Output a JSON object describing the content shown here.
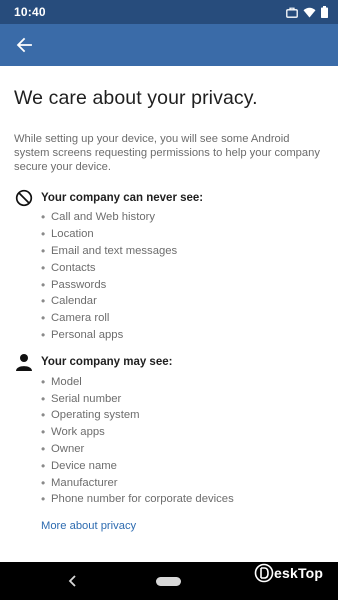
{
  "status_bar": {
    "time": "10:40",
    "icons": [
      "briefcase-icon",
      "wifi-icon",
      "battery-icon"
    ]
  },
  "app_bar": {
    "back_icon": "arrow-left-icon",
    "color": "#3a6ba8",
    "status_color": "#274c7c"
  },
  "page": {
    "title": "We care about your privacy.",
    "intro": "While setting up your device, you will see some Android system screens requesting permissions to help your company secure your device."
  },
  "never_see": {
    "icon": "blocked-icon",
    "title": "Your company can never see:",
    "items": [
      "Call and Web history",
      "Location",
      "Email and text messages",
      "Contacts",
      "Passwords",
      "Calendar",
      "Camera roll",
      "Personal apps"
    ]
  },
  "may_see": {
    "icon": "person-icon",
    "title": "Your company may see:",
    "items": [
      "Model",
      "Serial number",
      "Operating system",
      "Work apps",
      "Owner",
      "Device name",
      "Manufacturer",
      "Phone number for corporate devices"
    ]
  },
  "more_link": "More about privacy",
  "link_color": "#2d6bb0",
  "watermark": "eskTop"
}
